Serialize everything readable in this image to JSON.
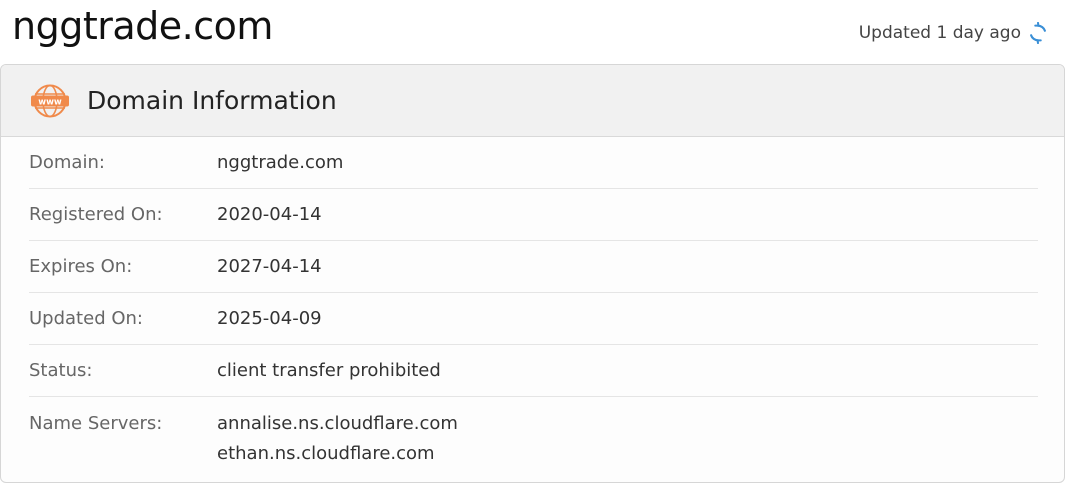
{
  "header": {
    "domain_title": "nggtrade.com",
    "updated_text": "Updated 1 day ago",
    "refresh_icon": "refresh-icon"
  },
  "panel": {
    "title": "Domain Information",
    "icon": "www-icon",
    "rows": [
      {
        "label": "Domain:",
        "value": "nggtrade.com"
      },
      {
        "label": "Registered On:",
        "value": "2020-04-14"
      },
      {
        "label": "Expires On:",
        "value": "2027-04-14"
      },
      {
        "label": "Updated On:",
        "value": "2025-04-09"
      },
      {
        "label": "Status:",
        "value": "client transfer prohibited"
      }
    ],
    "name_servers": {
      "label": "Name Servers:",
      "values": [
        "annalise.ns.cloudflare.com",
        "ethan.ns.cloudflare.com"
      ]
    }
  },
  "colors": {
    "accent_orange": "#f08a4b",
    "refresh_blue": "#3a8fd6"
  }
}
